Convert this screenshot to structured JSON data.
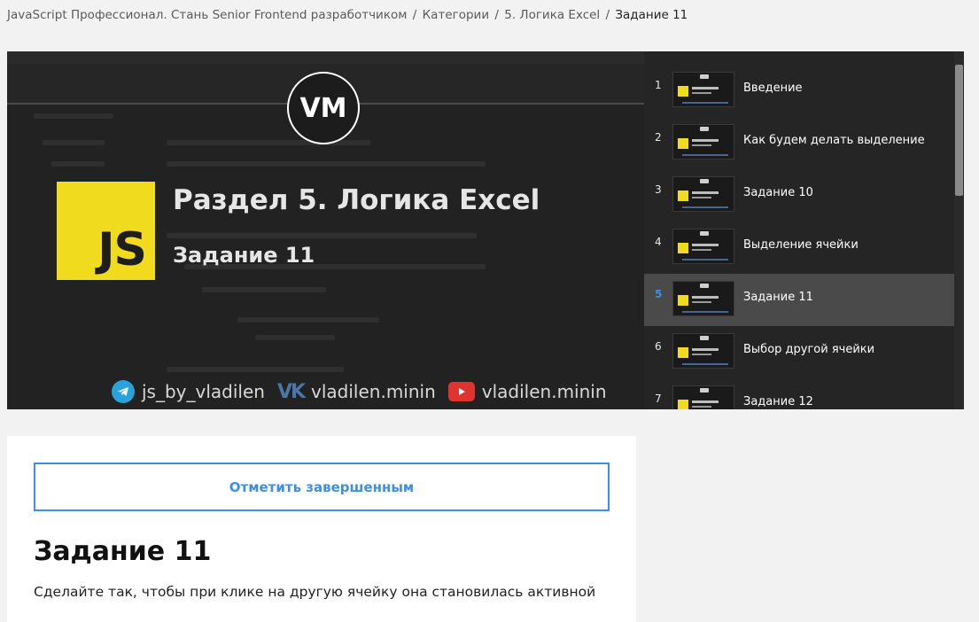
{
  "breadcrumb": {
    "course": "JavaScript Профессионал. Стань Senior Frontend разработчиком",
    "categories": "Категории",
    "section": "5. Логика Excel",
    "current": "Задание 11",
    "separator": "/"
  },
  "video": {
    "logo_text": "VM",
    "js_logo_text": "JS",
    "title": "Раздел 5. Логика Excel",
    "subtitle": "Задание 11",
    "socials": [
      {
        "icon": "telegram-icon",
        "handle": "js_by_vladilen"
      },
      {
        "icon": "vk-icon",
        "handle": "vladilen.minin"
      },
      {
        "icon": "youtube-icon",
        "handle": "vladilen.minin"
      }
    ],
    "vk_glyph": "VK"
  },
  "playlist": {
    "active_index": 5,
    "accent_color": "#3d8fe6",
    "items": [
      {
        "num": "1",
        "label": "Введение"
      },
      {
        "num": "2",
        "label": "Как будем делать выделение"
      },
      {
        "num": "3",
        "label": "Задание 10"
      },
      {
        "num": "4",
        "label": "Выделение ячейки"
      },
      {
        "num": "5",
        "label": "Задание 11"
      },
      {
        "num": "6",
        "label": "Выбор другой ячейки"
      },
      {
        "num": "7",
        "label": "Задание 12"
      }
    ]
  },
  "lesson": {
    "complete_button": "Отметить завершенным",
    "title": "Задание 11",
    "description": "Сделайте так, чтобы при клике на другую ячейку она становилась активной"
  }
}
